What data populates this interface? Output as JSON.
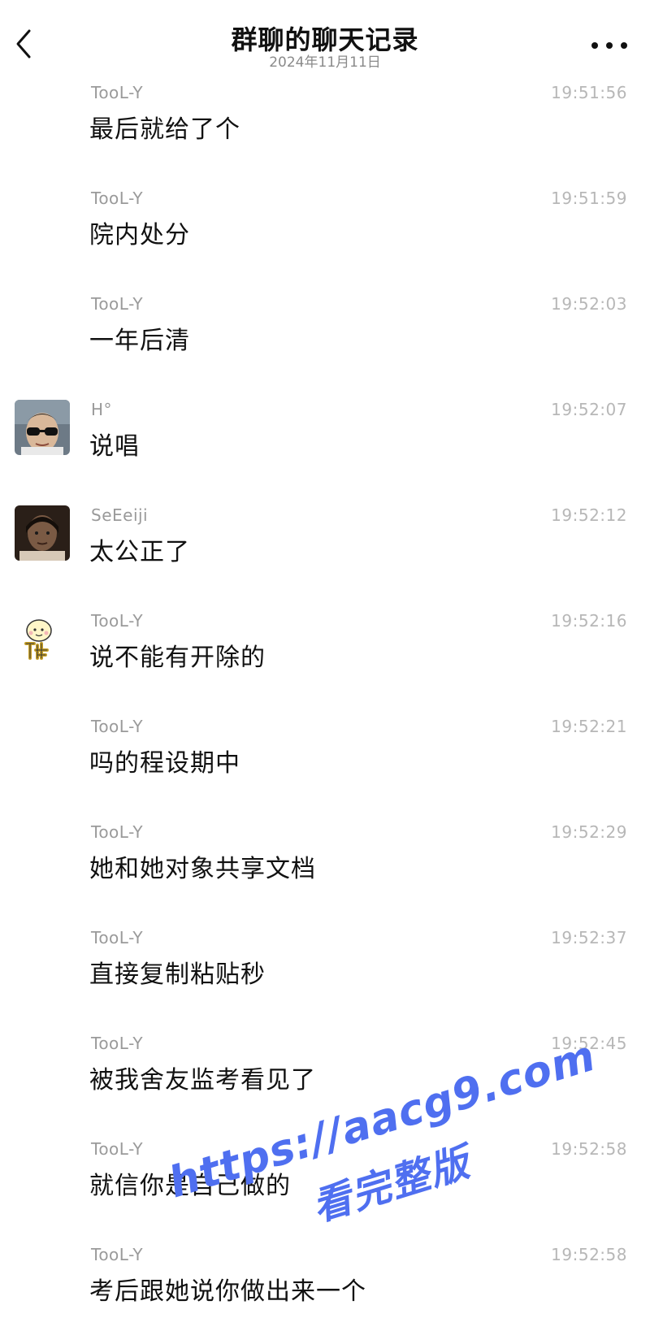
{
  "header": {
    "title": "群聊的聊天记录",
    "subtitle": "2024年11月11日"
  },
  "messages": [
    {
      "sender": "TooL-Y",
      "time": "19:51:56",
      "text": "最后就给了个",
      "avatar": "none"
    },
    {
      "sender": "TooL-Y",
      "time": "19:51:59",
      "text": "院内处分",
      "avatar": "none"
    },
    {
      "sender": "TooL-Y",
      "time": "19:52:03",
      "text": "一年后清",
      "avatar": "none"
    },
    {
      "sender": "H°",
      "time": "19:52:07",
      "text": "说唱",
      "avatar": "photo-sunglasses"
    },
    {
      "sender": "SeEeiji",
      "time": "19:52:12",
      "text": "太公正了",
      "avatar": "photo-dark"
    },
    {
      "sender": "TooL-Y",
      "time": "19:52:16",
      "text": "说不能有开除的",
      "avatar": "sticker-cartoon"
    },
    {
      "sender": "TooL-Y",
      "time": "19:52:21",
      "text": "吗的程设期中",
      "avatar": "none"
    },
    {
      "sender": "TooL-Y",
      "time": "19:52:29",
      "text": "她和她对象共享文档",
      "avatar": "none"
    },
    {
      "sender": "TooL-Y",
      "time": "19:52:37",
      "text": "直接复制粘贴秒",
      "avatar": "none"
    },
    {
      "sender": "TooL-Y",
      "time": "19:52:45",
      "text": "被我舍友监考看见了",
      "avatar": "none"
    },
    {
      "sender": "TooL-Y",
      "time": "19:52:58",
      "text": "就信你是自己做的",
      "avatar": "none"
    },
    {
      "sender": "TooL-Y",
      "time": "19:52:58",
      "text": "考后跟她说你做出来一个",
      "avatar": "none"
    }
  ],
  "watermark": {
    "url": "https://aacg9.com",
    "subtitle": "看完整版"
  },
  "colors": {
    "sender": "#9a9a9a",
    "time": "#b7b7b7",
    "text": "#111111",
    "watermark": "#4f6ff0"
  }
}
